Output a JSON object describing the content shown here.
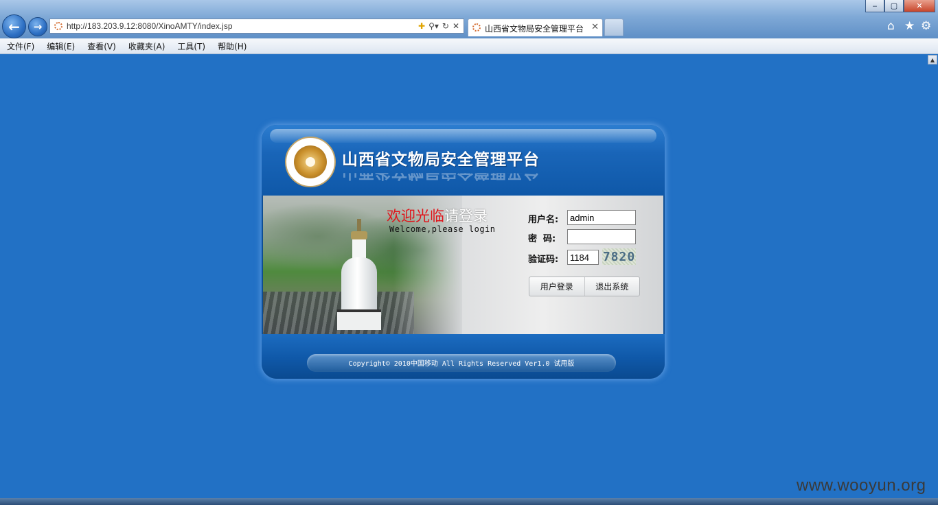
{
  "browser": {
    "url": "http://183.203.9.12:8080/XinoAMTY/index.jsp",
    "tab_title": "山西省文物局安全管理平台",
    "window_controls": {
      "minimize": "‒",
      "maximize": "▢",
      "close": "✕"
    },
    "menu": [
      "文件(F)",
      "编辑(E)",
      "查看(V)",
      "收藏夹(A)",
      "工具(T)",
      "帮助(H)"
    ],
    "icons": [
      "back-arrow-icon",
      "forward-arrow-icon",
      "compatibility-icon",
      "search-icon",
      "refresh-icon",
      "stop-icon",
      "home-icon",
      "favorites-star-icon",
      "settings-gear-icon"
    ]
  },
  "login": {
    "platform_title": "山西省文物局安全管理平台",
    "welcome_red": "欢迎光临",
    "welcome_white": "请登录",
    "welcome_en": "Welcome,please login",
    "username_label": "用户名:",
    "username_value": "admin",
    "password_label": "密  码:",
    "password_value": "",
    "captcha_label": "验证码:",
    "captcha_value": "1184",
    "captcha_image_text": "7820",
    "login_button": "用户登录",
    "exit_button": "退出系统",
    "copyright": "Copyright© 2010中国移动 All Rights Reserved Ver1.0 试用版"
  },
  "watermark": "www.wooyun.org",
  "colors": {
    "page_background": "#2271c5",
    "panel_blue": "#0f58a8",
    "welcome_red": "#e0141a"
  }
}
